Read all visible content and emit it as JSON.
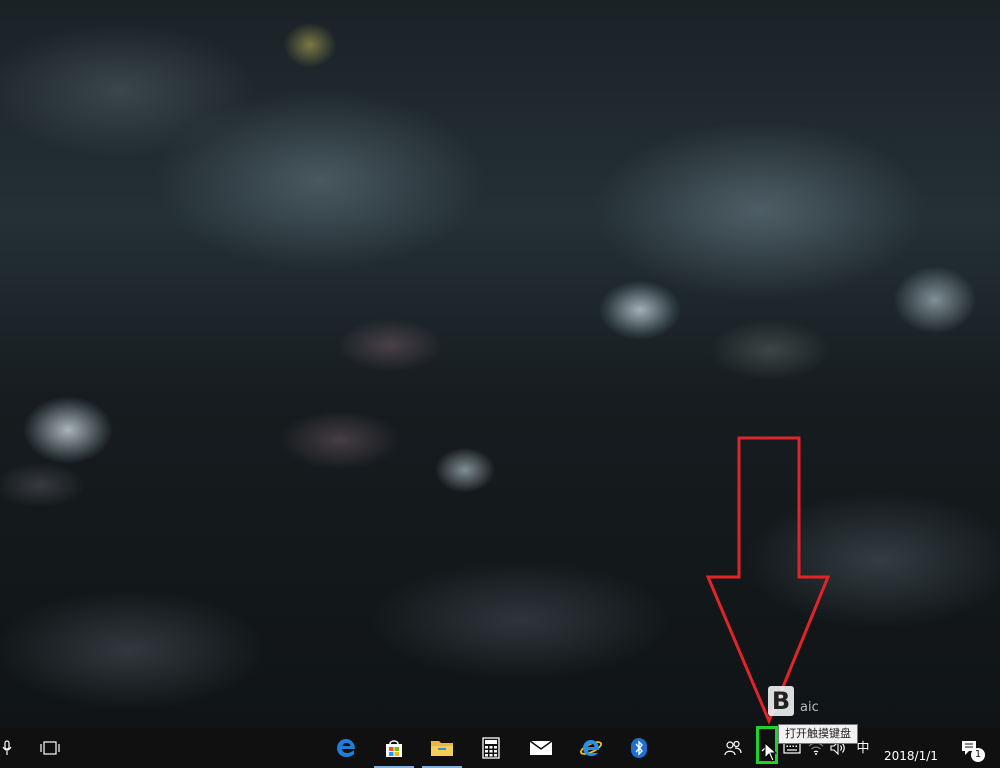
{
  "taskbar": {
    "clock": {
      "date": "2018/1/1"
    },
    "tray": {
      "ime": "中"
    },
    "tooltip": "打开触摸键盘",
    "apps": [
      {
        "name": "edge",
        "icon": "edge-icon"
      },
      {
        "name": "store",
        "icon": "store-icon"
      },
      {
        "name": "file-explorer",
        "icon": "folder-icon"
      },
      {
        "name": "calculator",
        "icon": "calculator-icon"
      },
      {
        "name": "mail",
        "icon": "mail-icon"
      },
      {
        "name": "internet-explorer",
        "icon": "ie-icon"
      },
      {
        "name": "bluetooth",
        "icon": "bluetooth-icon"
      }
    ],
    "notification_count": "1"
  },
  "watermark": {
    "logo_letter": "B",
    "text": "aic"
  },
  "colors": {
    "taskbar_bg": "#101010",
    "highlight_box": "#1fd12b",
    "arrow": "#e0242a",
    "accent": "#1e7fd8"
  }
}
